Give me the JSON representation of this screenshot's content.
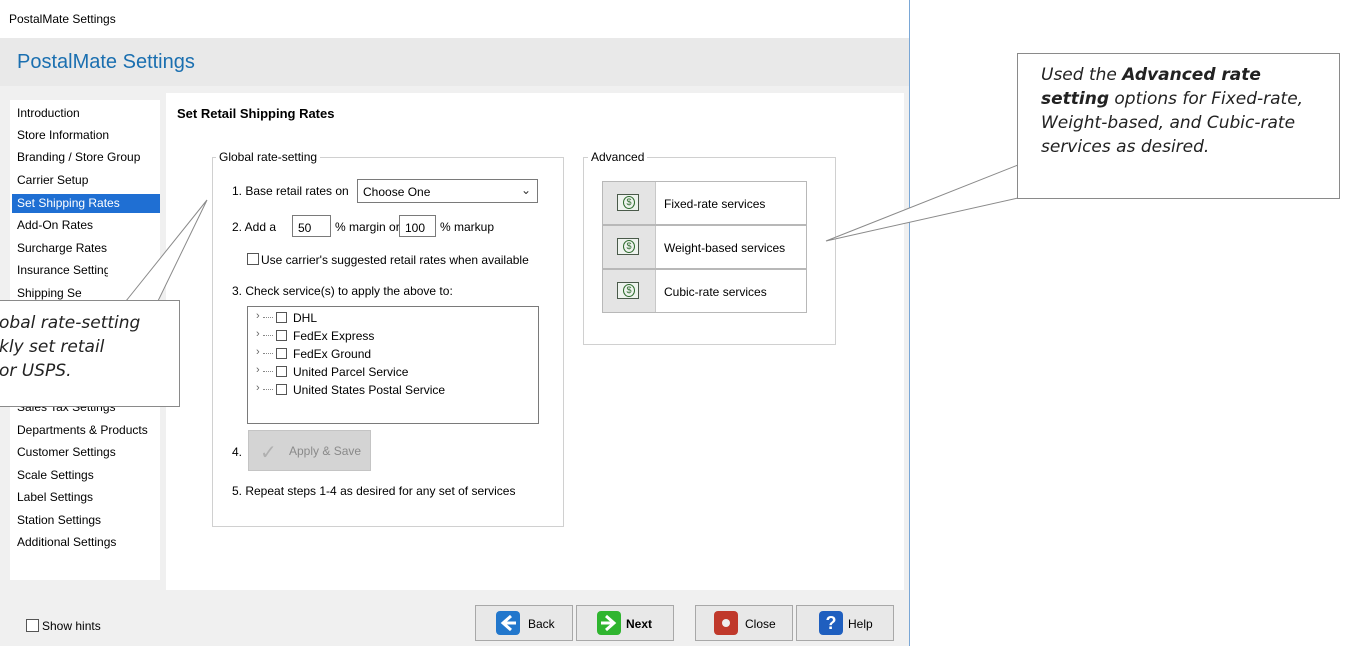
{
  "window": {
    "title": "PostalMate Settings",
    "header": "PostalMate Settings"
  },
  "sidebar": {
    "items": [
      {
        "label": "Introduction"
      },
      {
        "label": "Store Information"
      },
      {
        "label": "Branding / Store Group"
      },
      {
        "label": "Carrier Setup"
      },
      {
        "label": "Set Shipping Rates",
        "selected": true
      },
      {
        "label": "Add-On Rates"
      },
      {
        "label": "Surcharge Rates"
      },
      {
        "label": "Insurance Settings"
      },
      {
        "label": "Shipping Settings"
      },
      {
        "label": "Sales Tax Settings"
      },
      {
        "label": "Departments & Products"
      },
      {
        "label": "Customer Settings"
      },
      {
        "label": "Scale Settings"
      },
      {
        "label": "Label Settings"
      },
      {
        "label": "Station Settings"
      },
      {
        "label": "Additional Settings"
      }
    ]
  },
  "main": {
    "title": "Set Retail Shipping Rates",
    "global": {
      "legend": "Global rate-setting",
      "step1_label": "1.  Base retail rates on",
      "base_rates_select": "Choose One",
      "step2_prefix": "2.  Add a",
      "margin_value": "50",
      "margin_label": "% margin or",
      "markup_value": "100",
      "markup_label": "% markup",
      "suggested_rates_label": "Use carrier's suggested retail rates when available",
      "step3_label": "3.  Check service(s) to apply the above to:",
      "services": [
        "DHL",
        "FedEx Express",
        "FedEx Ground",
        "United Parcel Service",
        "United States Postal Service"
      ],
      "step4_label": "4.",
      "apply_label": "Apply & Save",
      "step5_label": "5.  Repeat steps 1-4 as desired for any set of services"
    },
    "advanced": {
      "legend": "Advanced",
      "buttons": [
        "Fixed-rate services",
        "Weight-based services",
        "Cubic-rate services"
      ]
    }
  },
  "footer": {
    "show_hints_label": "Show hints",
    "back_label": "Back",
    "next_label": "Next",
    "close_label": "Close",
    "help_label": "Help"
  },
  "callouts": {
    "left_lines": [
      "obal rate-setting",
      "kly set retail",
      "or USPS."
    ],
    "right_lines": [
      {
        "pre": "Used the ",
        "bold": "Advanced rate",
        "post": ""
      },
      {
        "pre": "",
        "bold": "setting",
        "post": " options for Fixed-rate,"
      },
      {
        "pre": "Weight-based, and Cubic-rate",
        "bold": "",
        "post": ""
      },
      {
        "pre": "services as desired.",
        "bold": "",
        "post": ""
      }
    ]
  },
  "colors": {
    "accent": "#1f6fd3",
    "header_text": "#1a6fb0",
    "next_icon": "#2fb52f",
    "back_icon": "#2277cc",
    "close_icon": "#c0392b",
    "help_icon": "#1f5fbf"
  }
}
